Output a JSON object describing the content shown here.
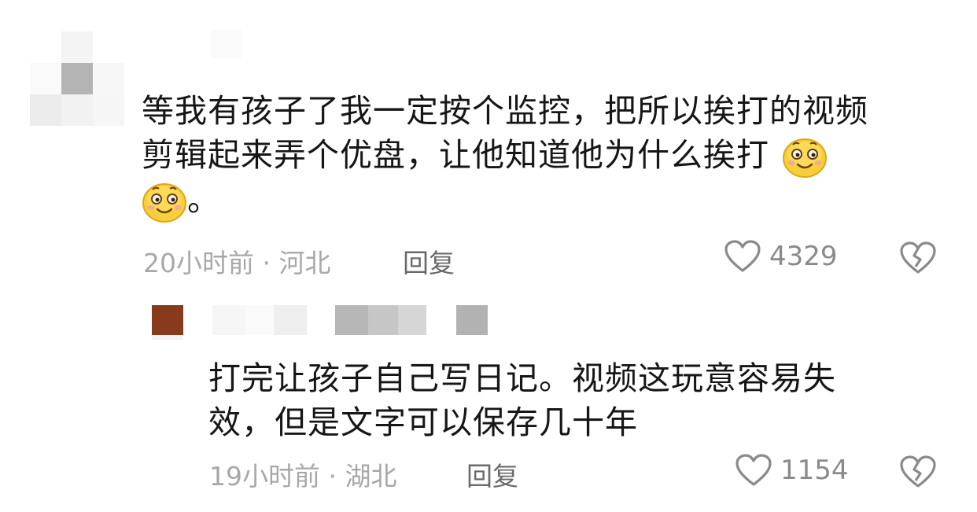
{
  "comments": [
    {
      "text_line1": "等我有孩子了我一定按个监控，把所以挨打的视频",
      "text_line2": "剪辑起来弄个优盘，让他知道他为什么挨打",
      "text_line3_suffix": "。",
      "emoji_icon": "smiling-face-emoji",
      "meta": "20小时前 · 河北",
      "reply_label": "回复",
      "likes": "4329"
    },
    {
      "text_line1": "打完让孩子自己写日记。视频这玩意容易失",
      "text_line2": "效，但是文字可以保存几十年",
      "meta": "19小时前 · 湖北",
      "reply_label": "回复",
      "likes": "1154"
    }
  ],
  "colors": {
    "text": "#161616",
    "meta": "#a8a8a8",
    "reply": "#6a6a6a",
    "icon": "#8a8a8a",
    "avatar_reply": "#8a3a1c"
  }
}
